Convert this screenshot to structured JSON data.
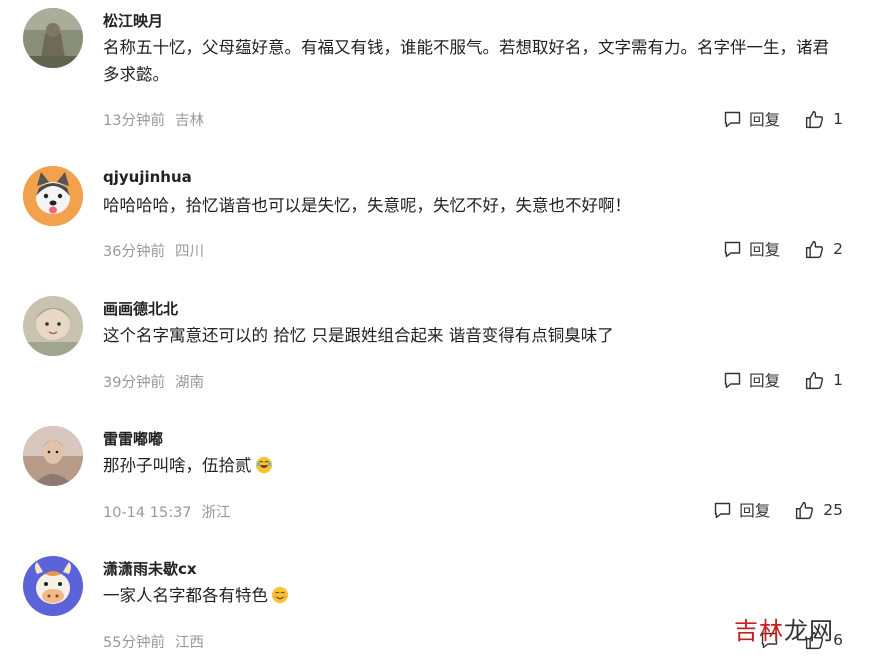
{
  "comments": [
    {
      "username": "松江映月",
      "text": "名称五十忆，父母蕴好意。有福又有钱，谁能不服气。若想取好名，文字需有力。名字伴一生，诸君多求懿。",
      "time": "13分钟前",
      "location": "吉林",
      "reply_label": "回复",
      "likes": "1",
      "avatar_icon": "stone-sculpture-avatar"
    },
    {
      "username": "qjyujinhua",
      "text": "哈哈哈哈，拾忆谐音也可以是失忆，失意呢，失忆不好，失意也不好啊！",
      "time": "36分钟前",
      "location": "四川",
      "reply_label": "回复",
      "likes": "2",
      "avatar_icon": "husky-dog-avatar"
    },
    {
      "username": "画画德北北",
      "text": "这个名字寓意还可以的 拾忆 只是跟姓组合起来 谐音变得有点铜臭味了",
      "time": "39分钟前",
      "location": "湖南",
      "reply_label": "回复",
      "likes": "1",
      "avatar_icon": "baby-photo-avatar"
    },
    {
      "username": "雷雷嘟嘟",
      "text": "那孙子叫啥，伍拾贰",
      "emoji": "laughing-emoji",
      "time": "10-14 15:37",
      "location": "浙江",
      "reply_label": "回复",
      "likes": "25",
      "avatar_icon": "man-portrait-avatar"
    },
    {
      "username": "潇潇雨未歇cx",
      "text": "一家人名字都各有特色",
      "emoji": "smiling-emoji",
      "time": "55分钟前",
      "location": "江西",
      "reply_label": "",
      "likes": "6",
      "avatar_icon": "cow-cartoon-avatar"
    }
  ],
  "watermark": {
    "part1": "吉林",
    "part2": "龙网"
  },
  "colors": {
    "meta": "#999999",
    "text": "#222222",
    "watermark_red": "#c82020"
  }
}
